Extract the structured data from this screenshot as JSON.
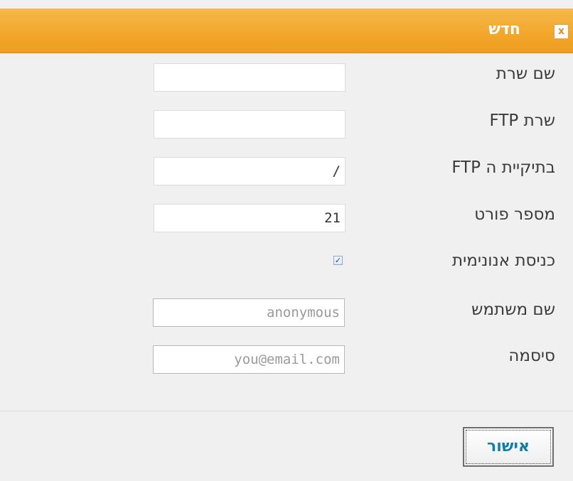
{
  "dialog": {
    "title": "חדש",
    "close_icon": "close-icon",
    "close_glyph": "x"
  },
  "form": {
    "server_name": {
      "label": "שם שרת",
      "value": ""
    },
    "ftp_server": {
      "label": "שרת FTP",
      "value": ""
    },
    "ftp_folder": {
      "label": "בתיקיית ה FTP",
      "value": "/"
    },
    "port": {
      "label": "מספר פורט",
      "value": "21"
    },
    "anonymous_login": {
      "label": "כניסת אנונימית",
      "checked": true,
      "check_glyph": "✓"
    },
    "username": {
      "label": "שם משתמש",
      "value": "anonymous"
    },
    "password": {
      "label": "סיסמה",
      "value": "you@email.com"
    }
  },
  "footer": {
    "ok_label": "אישור"
  },
  "colors": {
    "titlebar": "#f2a62a",
    "dialog_bg": "#f0f0f0",
    "ok_text": "#0e7fa8"
  }
}
